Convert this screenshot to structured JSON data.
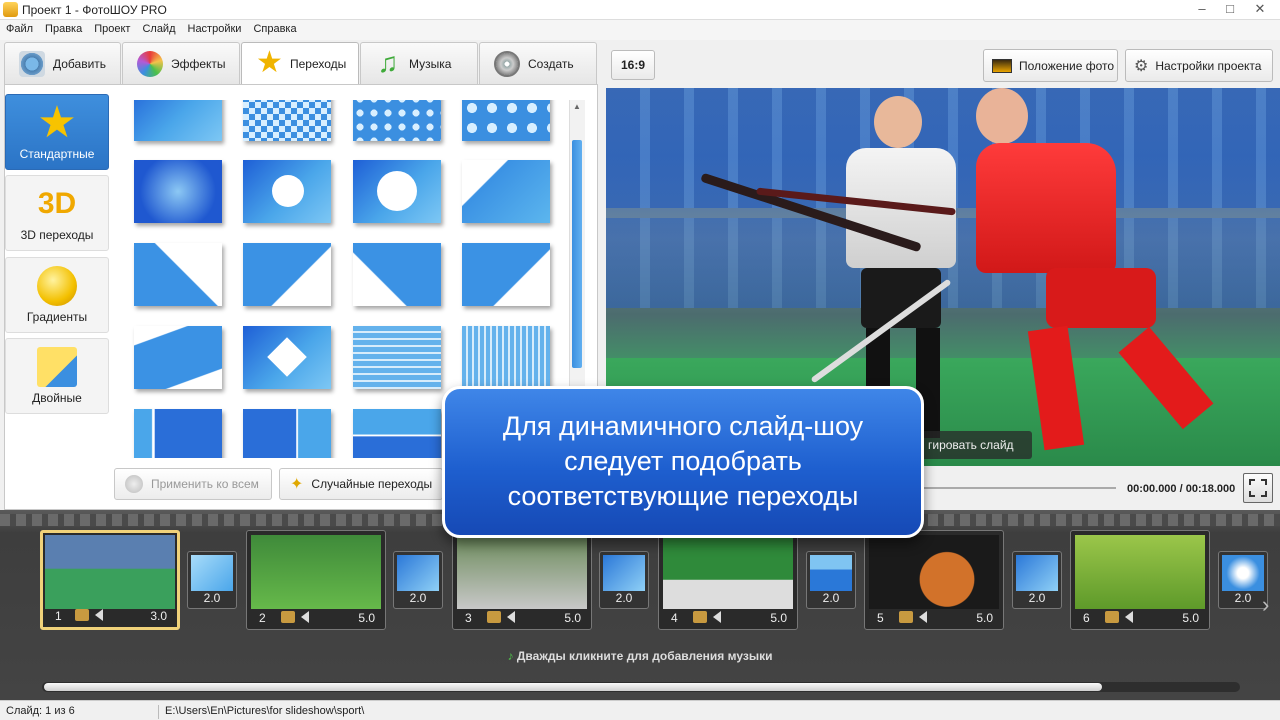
{
  "window": {
    "title": "Проект 1 - ФотоШОУ PRO"
  },
  "menu": [
    "Файл",
    "Правка",
    "Проект",
    "Слайд",
    "Настройки",
    "Справка"
  ],
  "tabs": [
    {
      "label": "Добавить",
      "icon": "camera-icon"
    },
    {
      "label": "Эффекты",
      "icon": "palette-icon"
    },
    {
      "label": "Переходы",
      "icon": "star-icon",
      "active": true
    },
    {
      "label": "Музыка",
      "icon": "music-note-icon"
    },
    {
      "label": "Создать",
      "icon": "disc-icon"
    }
  ],
  "categories": [
    {
      "label": "Стандартные",
      "icon": "star-icon",
      "active": true
    },
    {
      "label": "3D переходы",
      "icon": "3d-icon"
    },
    {
      "label": "Градиенты",
      "icon": "gradient-icon"
    },
    {
      "label": "Двойные",
      "icon": "double-icon"
    }
  ],
  "panel_buttons": {
    "apply_all": "Применить ко всем",
    "random": "Случайные переходы"
  },
  "preview_toolbar": {
    "ratio": "16:9",
    "photo_position": "Положение фото",
    "project_settings": "Настройки проекта"
  },
  "preview": {
    "edit_slide": "гировать слайд",
    "time": "00:00.000 / 00:18.000"
  },
  "caption": {
    "line1": "Для динамичного слайд-шоу",
    "line2": "следует подобрать",
    "line3": "соответствующие переходы"
  },
  "slides": [
    {
      "num": "1",
      "duration": "3.0"
    },
    {
      "num": "2",
      "duration": "5.0"
    },
    {
      "num": "3",
      "duration": "5.0"
    },
    {
      "num": "4",
      "duration": "5.0"
    },
    {
      "num": "5",
      "duration": "5.0"
    },
    {
      "num": "6",
      "duration": "5.0"
    }
  ],
  "transitions": [
    {
      "duration": "2.0"
    },
    {
      "duration": "2.0"
    },
    {
      "duration": "2.0"
    },
    {
      "duration": "2.0"
    },
    {
      "duration": "2.0"
    },
    {
      "duration": "2.0"
    }
  ],
  "music_hint": "Дважды кликните для добавления музыки",
  "status": {
    "slide": "Слайд: 1 из 6",
    "path": "E:\\Users\\En\\Pictures\\for slideshow\\sport\\"
  }
}
